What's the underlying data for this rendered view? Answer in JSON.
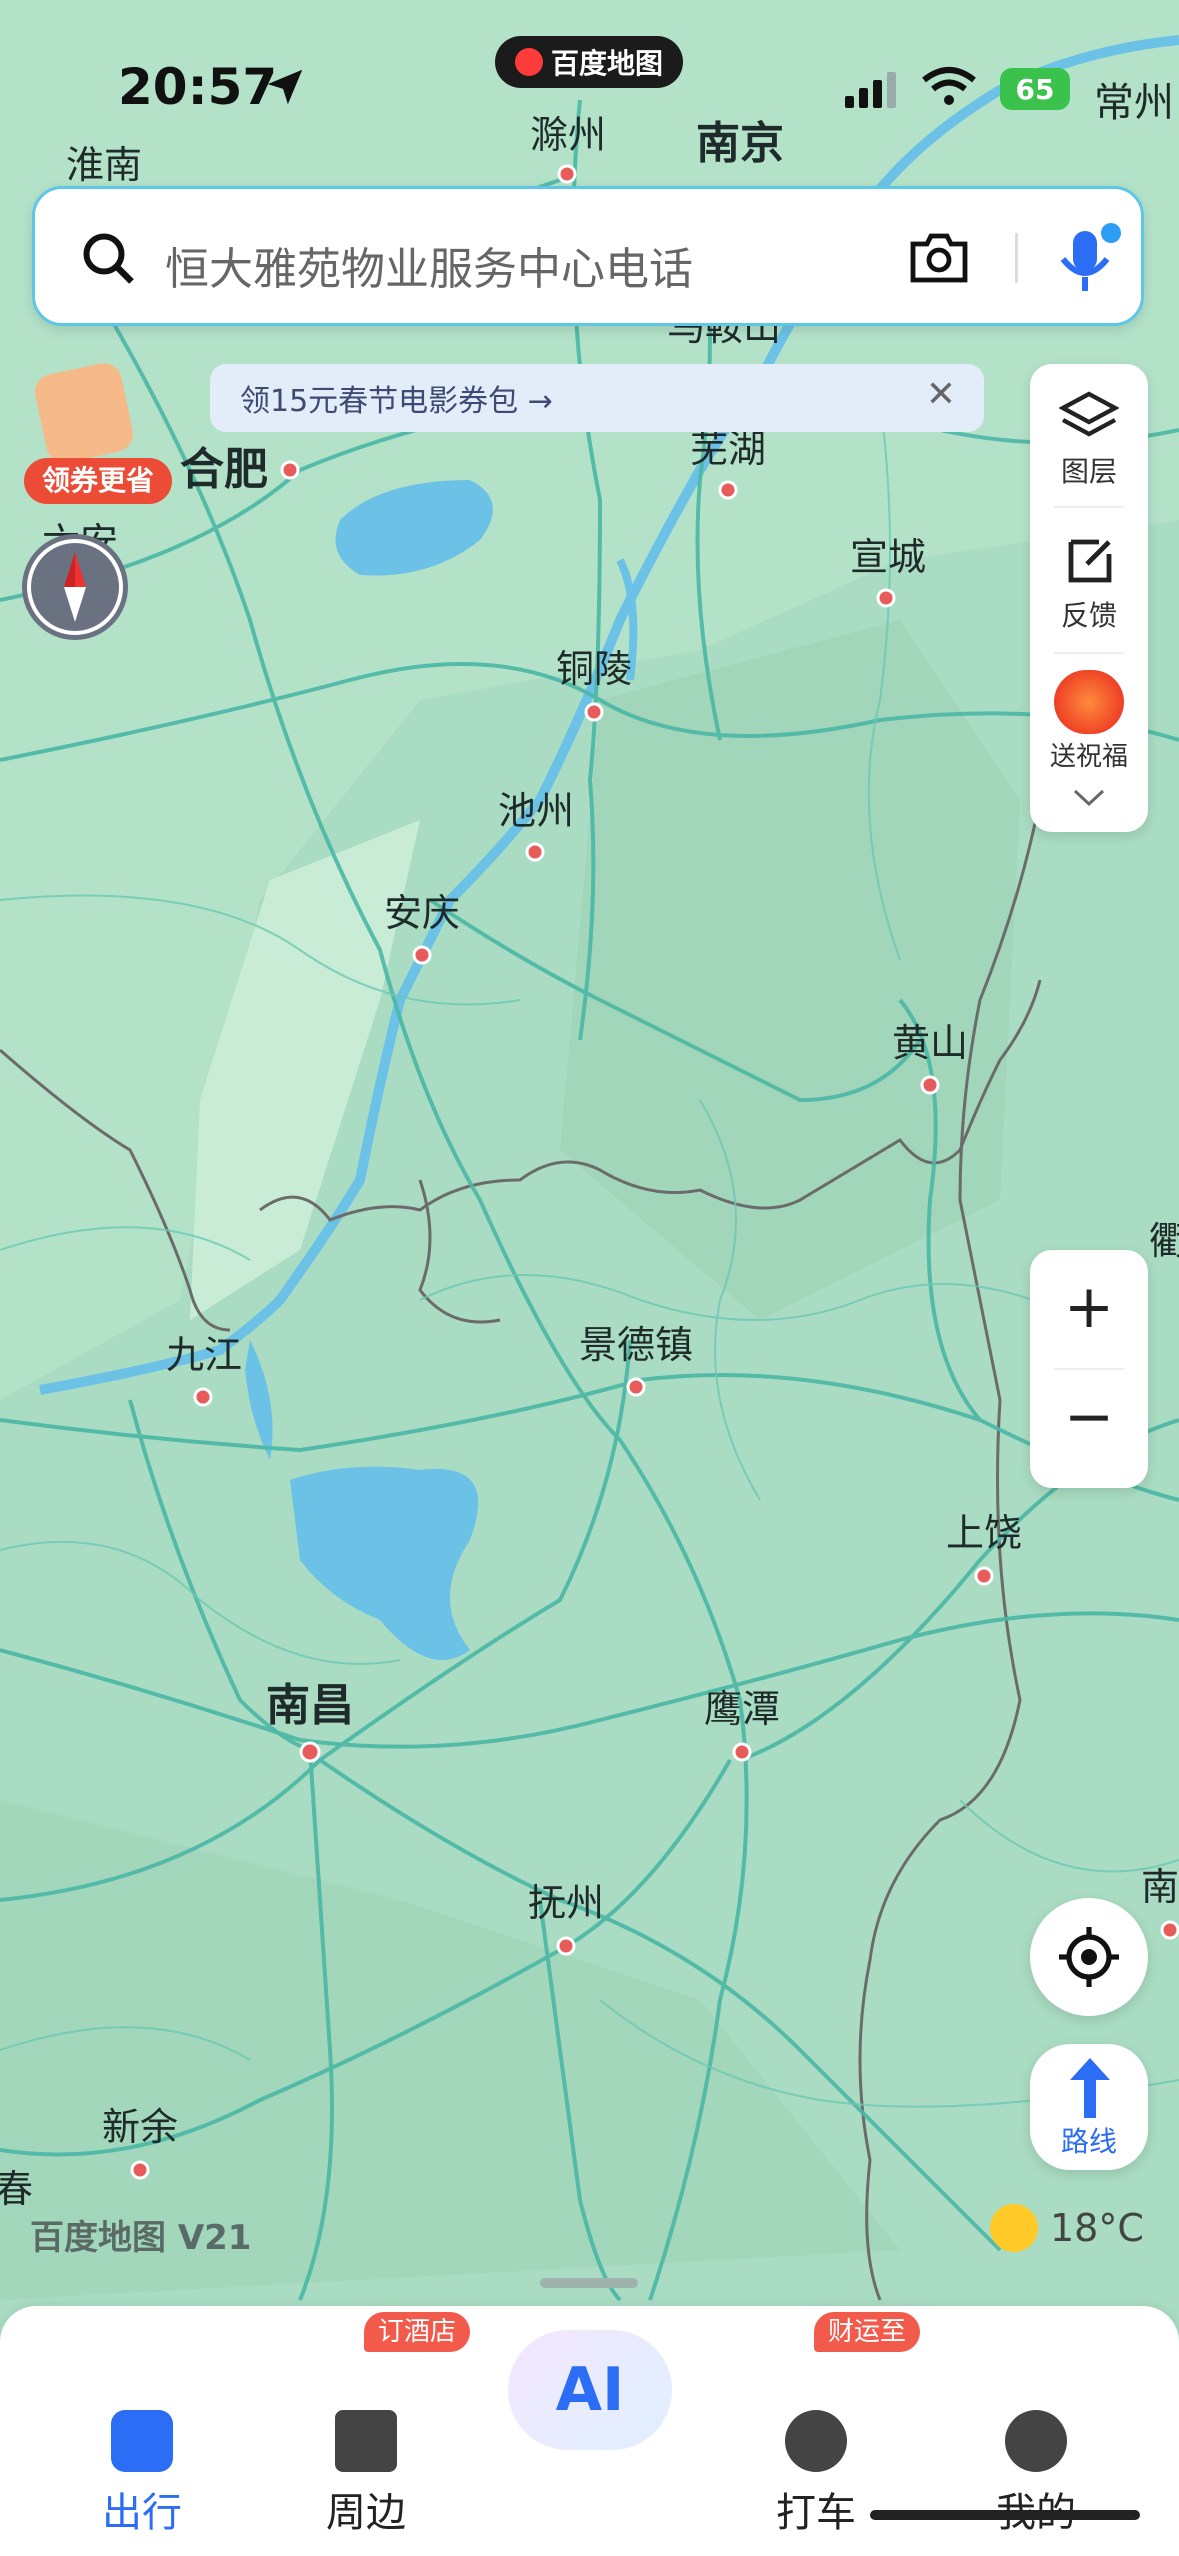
{
  "status_bar": {
    "time": "20:57",
    "app_badge": "百度地图",
    "battery": "65",
    "corner_city": "常州"
  },
  "search": {
    "placeholder": "恒大雅苑物业服务中心电话"
  },
  "banner": {
    "text": "领15元春节电影券包 →",
    "close": "✕"
  },
  "coupon": {
    "label": "领券更省"
  },
  "side_panel": {
    "layers": "图层",
    "feedback": "反馈",
    "blessing": "送祝福"
  },
  "zoom": {
    "in": "+",
    "out": "−"
  },
  "route_button": {
    "label": "路线"
  },
  "map": {
    "cities": [
      {
        "name": "淮南",
        "major": false
      },
      {
        "name": "滁州",
        "major": false
      },
      {
        "name": "南京",
        "major": true
      },
      {
        "name": "马鞍山",
        "major": false
      },
      {
        "name": "合肥",
        "major": true
      },
      {
        "name": "芜湖",
        "major": false
      },
      {
        "name": "六安",
        "major": false
      },
      {
        "name": "宣城",
        "major": false
      },
      {
        "name": "铜陵",
        "major": false
      },
      {
        "name": "池州",
        "major": false
      },
      {
        "name": "安庆",
        "major": false
      },
      {
        "name": "黄山",
        "major": false
      },
      {
        "name": "衢",
        "major": false
      },
      {
        "name": "九江",
        "major": false
      },
      {
        "name": "景德镇",
        "major": false
      },
      {
        "name": "上饶",
        "major": false
      },
      {
        "name": "南昌",
        "major": true
      },
      {
        "name": "鹰潭",
        "major": false
      },
      {
        "name": "南",
        "major": false
      },
      {
        "name": "抚州",
        "major": false
      },
      {
        "name": "新余",
        "major": false
      },
      {
        "name": "春",
        "major": false
      }
    ]
  },
  "watermark": "百度地图 V21",
  "weather": {
    "temp": "18°C"
  },
  "tabbar": {
    "tabs": [
      {
        "label": "出行",
        "active": true
      },
      {
        "label": "周边",
        "badge": "订酒店"
      },
      {
        "label": "AI"
      },
      {
        "label": "打车",
        "badge": "财运至"
      },
      {
        "label": "我的"
      }
    ]
  },
  "colors": {
    "accent": "#2b6df5",
    "map_green": "#a9dcc2",
    "road": "#4bb7a6",
    "water": "#6cc2e6",
    "badge": "#f25a4b"
  }
}
